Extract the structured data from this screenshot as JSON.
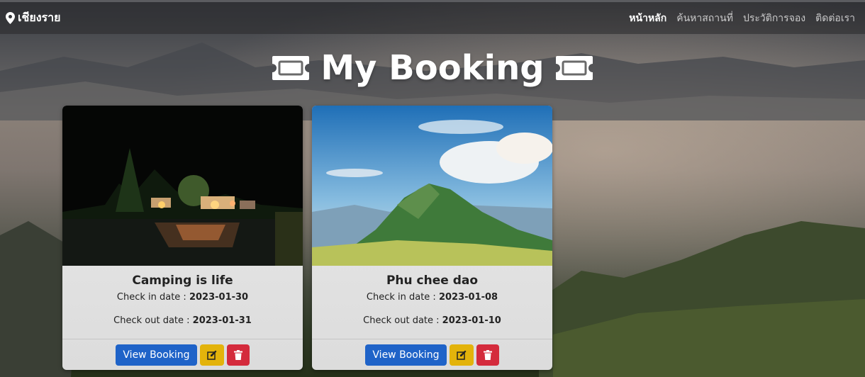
{
  "navbar": {
    "brand": "เชียงราย",
    "links": [
      {
        "label": "หน้าหลัก",
        "active": true
      },
      {
        "label": "ค้นหาสถานที่",
        "active": false
      },
      {
        "label": "ประวัติการจอง",
        "active": false
      },
      {
        "label": "ติดต่อเรา",
        "active": false
      }
    ]
  },
  "page": {
    "title": "My Booking",
    "title_icon": "ticket-icon"
  },
  "bookings": [
    {
      "name": "Camping is life",
      "checkin_label": "Check in date : ",
      "checkin_date": "2023-01-30",
      "checkout_label": "Check out date : ",
      "checkout_date": "2023-01-31",
      "view_label": "View Booking",
      "image": "night-campsite"
    },
    {
      "name": "Phu chee dao",
      "checkin_label": "Check in date : ",
      "checkin_date": "2023-01-08",
      "checkout_label": "Check out date : ",
      "checkout_date": "2023-01-10",
      "view_label": "View Booking",
      "image": "green-mountain"
    }
  ],
  "colors": {
    "view_button": "#1f63c8",
    "edit_button": "#e3b30b",
    "delete_button": "#d42b3c"
  }
}
